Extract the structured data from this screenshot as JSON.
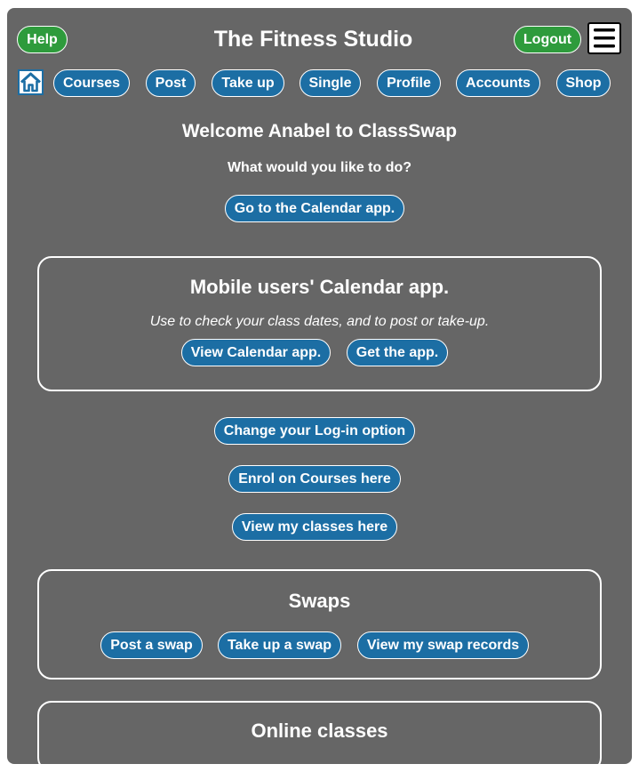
{
  "header": {
    "title": "The Fitness Studio",
    "help_label": "Help",
    "logout_label": "Logout",
    "menu_icon": "hamburger-menu-icon",
    "home_icon": "home-icon"
  },
  "nav": {
    "items": [
      {
        "label": "Courses"
      },
      {
        "label": "Post"
      },
      {
        "label": "Take up"
      },
      {
        "label": "Single"
      },
      {
        "label": "Profile"
      },
      {
        "label": "Accounts"
      },
      {
        "label": "Shop"
      }
    ]
  },
  "welcome": {
    "heading": "Welcome Anabel to ClassSwap",
    "question": "What would you like to do?",
    "calendar_button": "Go to the Calendar app."
  },
  "mobile_box": {
    "title": "Mobile users' Calendar app.",
    "description": "Use to check your class dates, and to post or take-up.",
    "view_button": "View Calendar app.",
    "get_button": "Get the app."
  },
  "actions": {
    "login_option": "Change your Log-in option",
    "enrol": "Enrol on Courses here",
    "view_classes": "View my classes here"
  },
  "swaps_box": {
    "title": "Swaps",
    "post": "Post a swap",
    "take_up": "Take up a swap",
    "records": "View my swap records"
  },
  "online_box": {
    "title": "Online classes"
  },
  "colors": {
    "panel_bg": "#666666",
    "button_blue": "#1c6ea4",
    "button_green": "#2e9b3c",
    "text": "#ffffff"
  }
}
